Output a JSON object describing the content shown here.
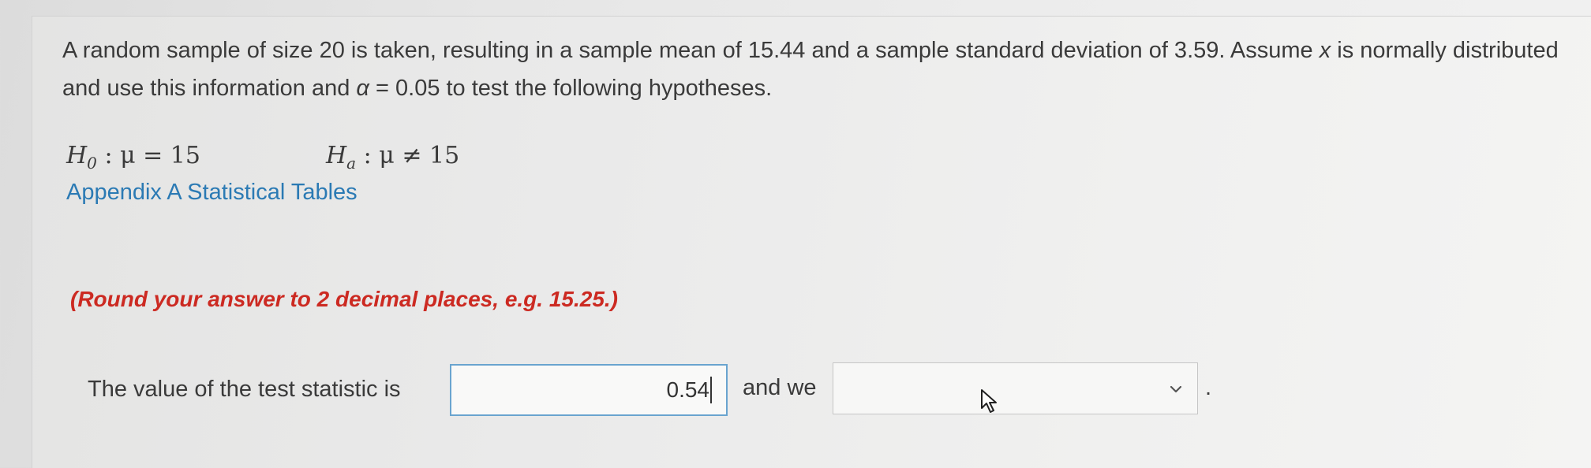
{
  "question": {
    "text_before_x": "A random sample of size 20 is taken, resulting in a sample mean of 15.44 and a sample standard deviation of 3.59. Assume ",
    "variable": "x",
    "text_before_alpha": " is normally distributed and use this information and ",
    "alpha_symbol": "α",
    "text_after_alpha": " = 0.05 to test the following hypotheses."
  },
  "hypotheses": {
    "null": {
      "symbol": "H",
      "subscript": "0",
      "operator": " : μ = 15"
    },
    "alternative": {
      "symbol": "H",
      "subscript": "a",
      "operator": " : μ ≠ 15"
    }
  },
  "appendix_link": "Appendix A Statistical Tables",
  "round_note": "(Round your answer to 2 decimal places, e.g. 15.25.)",
  "answer": {
    "label": "The value of the test statistic is",
    "test_statistic_value": "0.54",
    "connector": "and we",
    "decision_selected": "",
    "end_punctuation": "."
  },
  "icons": {
    "dropdown": "chevron-down-icon",
    "cursor": "mouse-pointer-icon"
  },
  "colors": {
    "text": "#3a3a3a",
    "link": "#2b7ab4",
    "note": "#cc2a22",
    "input_border_active": "#6aa4cf"
  }
}
